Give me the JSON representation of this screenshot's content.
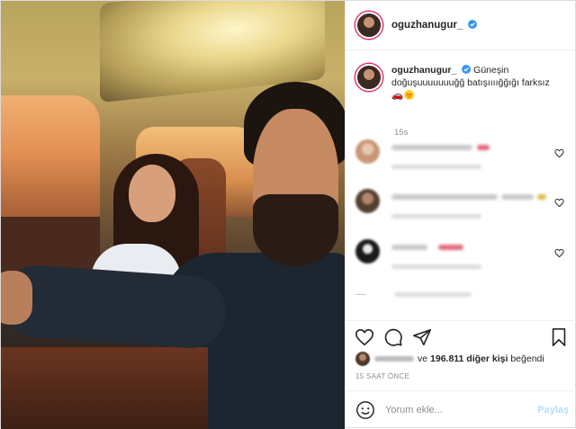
{
  "post": {
    "username": "oguzhanugur_",
    "verified": true,
    "caption_text": "Güneşin doğuşuuuuuuuğğ batışıııığğığı farksız 🚗🌞",
    "caption_time": "15s"
  },
  "likes": {
    "prefix": "ve",
    "count": "196.811 diğer kişi",
    "suffix": "beğendi"
  },
  "timestamp": "15 SAAT ÖNCE",
  "comment_input": {
    "placeholder": "Yorum ekle...",
    "post_label": "Paylaş"
  },
  "icons": {
    "verified": "verified-badge-icon",
    "heart": "heart-icon",
    "comment": "comment-icon",
    "share": "share-icon",
    "save": "bookmark-icon",
    "emoji": "emoji-icon"
  },
  "colors": {
    "verified": "#3897f0",
    "post_button": "#b2dffc",
    "muted_text": "#8e8e8e"
  }
}
